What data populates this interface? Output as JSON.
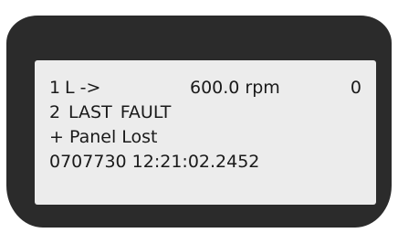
{
  "display": {
    "row1": {
      "ref_num": "1",
      "control_location": "L ->",
      "speed": "600.0 rpm",
      "status": "0"
    },
    "row2": {
      "fault_number": "2",
      "fault_title": "LAST FAULT"
    },
    "row3": {
      "fault_name": "+ Panel Lost"
    },
    "row4": {
      "timestamp": "0707730 12:21:02.2452"
    }
  },
  "colors": {
    "bezel": "#2b2b2b",
    "screen": "#ececec",
    "text": "#1a1a1a"
  }
}
